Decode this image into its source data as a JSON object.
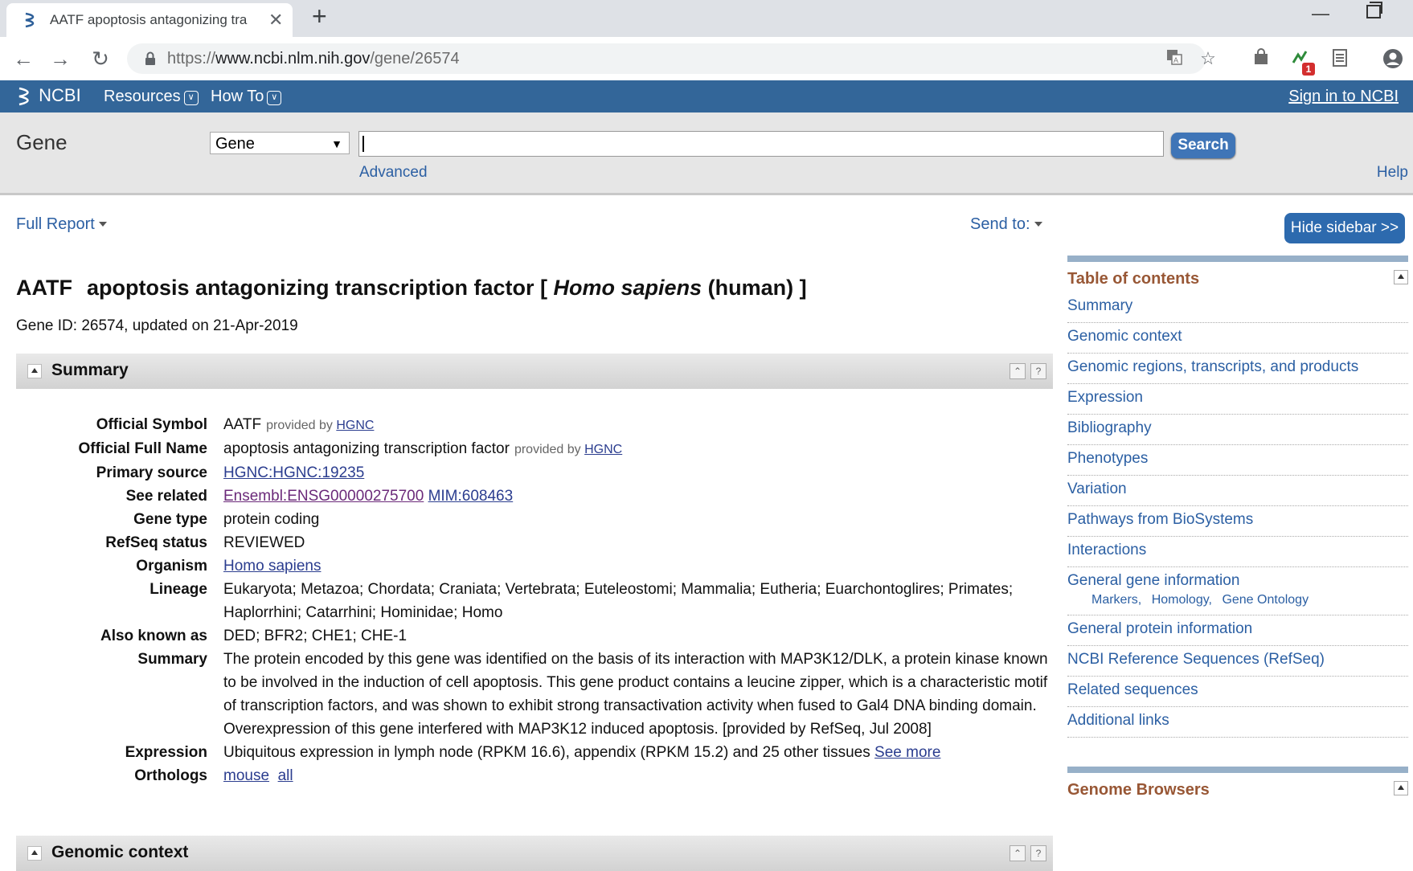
{
  "browser": {
    "tab_title": "AATF apoptosis antagonizing tra",
    "new_tab": "+",
    "url_prefix": "https://",
    "url_host": "www.ncbi.nlm.nih.gov",
    "url_path": "/gene/26574",
    "extension_badge": "1"
  },
  "ncbi": {
    "logo": "NCBI",
    "resources": "Resources",
    "how_to": "How To",
    "sign_in": "Sign in to NCBI"
  },
  "search": {
    "db_title": "Gene",
    "db_selected": "Gene",
    "query": "",
    "button": "Search",
    "advanced": "Advanced",
    "help": "Help"
  },
  "page": {
    "full_report": "Full Report",
    "send_to": "Send to:",
    "hide_sidebar": "Hide sidebar >>",
    "heading_symbol": "AATF",
    "heading_name": "apoptosis antagonizing transcription factor [",
    "heading_species": "Homo sapiens",
    "heading_common": "(human) ]",
    "gene_id": "Gene ID: 26574, updated on 21-Apr-2019"
  },
  "sections": {
    "summary": "Summary",
    "genomic_context": "Genomic context"
  },
  "summary": {
    "provided_by": "provided by",
    "hgnc": "HGNC",
    "official_symbol_label": "Official Symbol",
    "official_symbol": "AATF",
    "official_full_name_label": "Official Full Name",
    "official_full_name": "apoptosis antagonizing transcription factor",
    "primary_source_label": "Primary source",
    "primary_source": "HGNC:HGNC:19235",
    "see_related_label": "See related",
    "see_related_1": "Ensembl:ENSG00000275700",
    "see_related_2": "MIM:608463",
    "gene_type_label": "Gene type",
    "gene_type": "protein coding",
    "refseq_status_label": "RefSeq status",
    "refseq_status": "REVIEWED",
    "organism_label": "Organism",
    "organism": "Homo sapiens",
    "lineage_label": "Lineage",
    "lineage": "Eukaryota; Metazoa; Chordata; Craniata; Vertebrata; Euteleostomi; Mammalia; Eutheria; Euarchontoglires; Primates; Haplorrhini; Catarrhini; Hominidae; Homo",
    "also_known_as_label": "Also known as",
    "also_known_as": "DED; BFR2; CHE1; CHE-1",
    "summary_label": "Summary",
    "summary_text": "The protein encoded by this gene was identified on the basis of its interaction with MAP3K12/DLK, a protein kinase known to be involved in the induction of cell apoptosis. This gene product contains a leucine zipper, which is a characteristic motif of transcription factors, and was shown to exhibit strong transactivation activity when fused to Gal4 DNA binding domain. Overexpression of this gene interfered with MAP3K12 induced apoptosis. [provided by RefSeq, Jul 2008]",
    "expression_label": "Expression",
    "expression": "Ubiquitous expression in lymph node (RPKM 16.6), appendix (RPKM 15.2) and 25 other tissues",
    "see_more": "See more",
    "orthologs_label": "Orthologs",
    "ortholog_mouse": "mouse",
    "ortholog_all": "all"
  },
  "sidebar": {
    "toc_title": "Table of contents",
    "toc": [
      "Summary",
      "Genomic context",
      "Genomic regions, transcripts, and products",
      "Expression",
      "Bibliography",
      "Phenotypes",
      "Variation",
      "Pathways from BioSystems",
      "Interactions",
      "General gene information",
      "General protein information",
      "NCBI Reference Sequences (RefSeq)",
      "Related sequences",
      "Additional links"
    ],
    "toc_sub": [
      "Markers,",
      "Homology,",
      "Gene Ontology"
    ],
    "genome_browsers": "Genome Browsers"
  },
  "colors": {
    "ncbi_blue": "#336699",
    "link": "#2b5fa3",
    "sidebar_heading": "#985735"
  }
}
